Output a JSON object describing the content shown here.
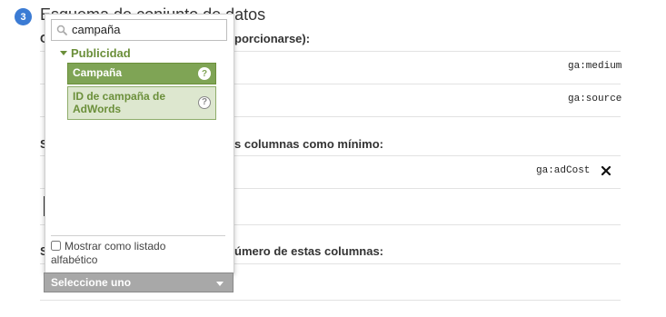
{
  "step": {
    "number": "3",
    "title": "Esquema de conjunto de datos"
  },
  "labels": {
    "required_key_fragment": "porcionarse):",
    "min_columns_fragment": "s columnas como mínimo:",
    "any_columns_fragment": "úmero de estas columnas:"
  },
  "rows": {
    "medium": "ga:medium",
    "source": "ga:source",
    "adcost": "ga:adCost"
  },
  "picker": {
    "search_value": "campaña",
    "group": "Publicidad",
    "options": [
      {
        "label": "Campaña",
        "help": "?",
        "selected": true
      },
      {
        "label": "ID de campaña de AdWords",
        "help": "?",
        "selected": false
      }
    ],
    "alphabetical_label": "Mostrar como listado alfabético"
  },
  "select_button": {
    "label": "Seleccione uno"
  },
  "colors": {
    "accent_green": "#7fa455",
    "badge_blue": "#3b7bd4"
  }
}
